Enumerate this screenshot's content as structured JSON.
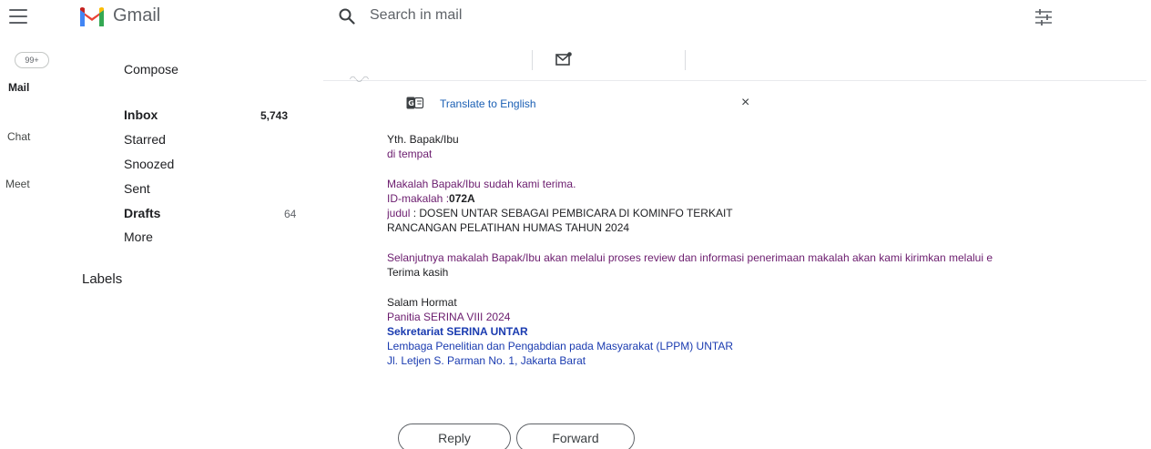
{
  "header": {
    "app_name": "Gmail",
    "search_placeholder": "Search in mail",
    "icons": [
      "menu-icon",
      "gmail-logo",
      "search-icon",
      "filter-options-icon"
    ]
  },
  "rail": {
    "badge": "99+",
    "items": [
      {
        "label": "Mail"
      },
      {
        "label": "Chat"
      },
      {
        "label": "Meet"
      }
    ]
  },
  "nav": {
    "compose": "Compose",
    "items": [
      {
        "label": "Inbox",
        "count": "5,743"
      },
      {
        "label": "Starred",
        "count": ""
      },
      {
        "label": "Snoozed",
        "count": ""
      },
      {
        "label": "Sent",
        "count": ""
      },
      {
        "label": "Drafts",
        "count": "64"
      },
      {
        "label": "More",
        "count": ""
      }
    ],
    "labels_heading": "Labels"
  },
  "translate": {
    "link": "Translate to English",
    "close": "×"
  },
  "message": {
    "greeting1": "Yth. Bapak/Ibu",
    "greeting2": "di tempat",
    "received": "Makalah Bapak/Ibu sudah kami terima.",
    "id_label": "ID-makalah :",
    "id_value": "072A",
    "judul_label": "judul",
    "judul_value": " : DOSEN UNTAR SEBAGAI PEMBICARA DI KOMINFO TERKAIT",
    "judul_line2": "RANCANGAN PELATIHAN HUMAS TAHUN 2024",
    "review": "Selanjutnya makalah Bapak/Ibu akan melalui proses review dan informasi penerimaan makalah akan kami kirimkan melalui e",
    "thanks": "Terima kasih",
    "closing": "Salam Hormat",
    "sig1": "Panitia SERINA VIII 2024",
    "sig2": "Sekretariat SERINA UNTAR",
    "sig3": "Lembaga Penelitian dan Pengabdian pada Masyarakat (LPPM) UNTAR",
    "sig4": "Jl. Letjen S. Parman No. 1, Jakarta Barat"
  },
  "actions": {
    "reply": "Reply",
    "forward": "Forward"
  },
  "colors": {
    "body_purple": "#6b1c6e",
    "signature_blue": "#1a3bb0",
    "link_blue": "#1a5fb4"
  }
}
